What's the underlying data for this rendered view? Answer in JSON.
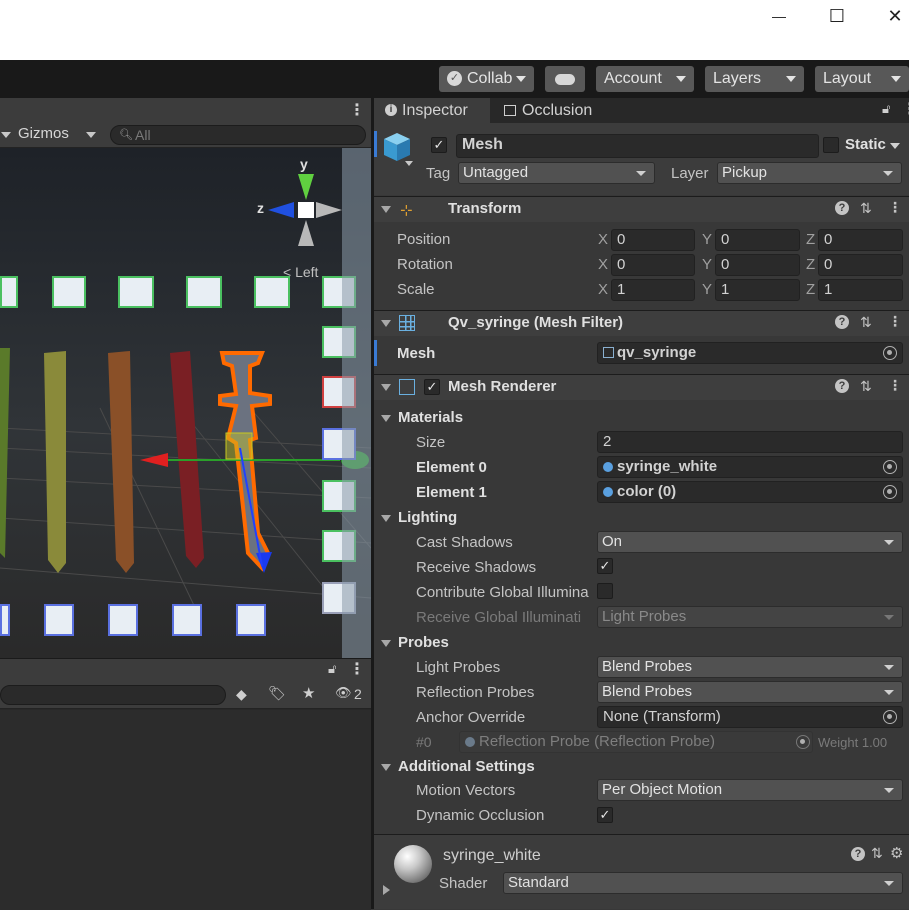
{
  "window": {
    "minimize": "—",
    "maximize": "☐",
    "close": "✕"
  },
  "toolbar": {
    "collab": "Collab",
    "account": "Account",
    "layers": "Layers",
    "layout": "Layout"
  },
  "scene": {
    "gizmos": "Gizmos",
    "search_placeholder": "All",
    "axis_y": "y",
    "axis_z": "z",
    "view_label": "< Left",
    "hidden_count": "2"
  },
  "inspector": {
    "tabs": [
      {
        "label": "Inspector"
      },
      {
        "label": "Occlusion"
      }
    ],
    "object": {
      "name": "Mesh",
      "static_label": "Static",
      "tag_label": "Tag",
      "tag_value": "Untagged",
      "layer_label": "Layer",
      "layer_value": "Pickup"
    },
    "transform": {
      "title": "Transform",
      "rows": [
        {
          "label": "Position",
          "x": "0",
          "y": "0",
          "z": "0"
        },
        {
          "label": "Rotation",
          "x": "0",
          "y": "0",
          "z": "0"
        },
        {
          "label": "Scale",
          "x": "1",
          "y": "1",
          "z": "1"
        }
      ],
      "axis_x": "X",
      "axis_y": "Y",
      "axis_z": "Z"
    },
    "mesh_filter": {
      "title": "Qv_syringe (Mesh Filter)",
      "mesh_label": "Mesh",
      "mesh_value": "qv_syringe"
    },
    "mesh_renderer": {
      "title": "Mesh Renderer",
      "materials_label": "Materials",
      "size_label": "Size",
      "size_value": "2",
      "element0_label": "Element 0",
      "element0_value": "syringe_white",
      "element1_label": "Element 1",
      "element1_value": "color (0)",
      "lighting_label": "Lighting",
      "cast_shadows_label": "Cast Shadows",
      "cast_shadows_value": "On",
      "receive_shadows_label": "Receive Shadows",
      "contribute_gi_label": "Contribute Global Illumina",
      "receive_gi_label": "Receive Global Illuminati",
      "receive_gi_value": "Light Probes",
      "probes_label": "Probes",
      "light_probes_label": "Light Probes",
      "light_probes_value": "Blend Probes",
      "reflection_probes_label": "Reflection Probes",
      "reflection_probes_value": "Blend Probes",
      "anchor_label": "Anchor Override",
      "anchor_value": "None (Transform)",
      "probe_index": "#0",
      "probe_value": "Reflection Probe (Reflection Probe)",
      "probe_weight": "Weight 1.00",
      "additional_label": "Additional Settings",
      "motion_label": "Motion Vectors",
      "motion_value": "Per Object Motion",
      "dynocc_label": "Dynamic Occlusion"
    },
    "material": {
      "name": "syringe_white",
      "shader_label": "Shader",
      "shader_value": "Standard"
    }
  },
  "colors": {
    "accent": "#3a7bd5",
    "selection_outline": "#ff6a00",
    "panel_bg": "#383838"
  }
}
